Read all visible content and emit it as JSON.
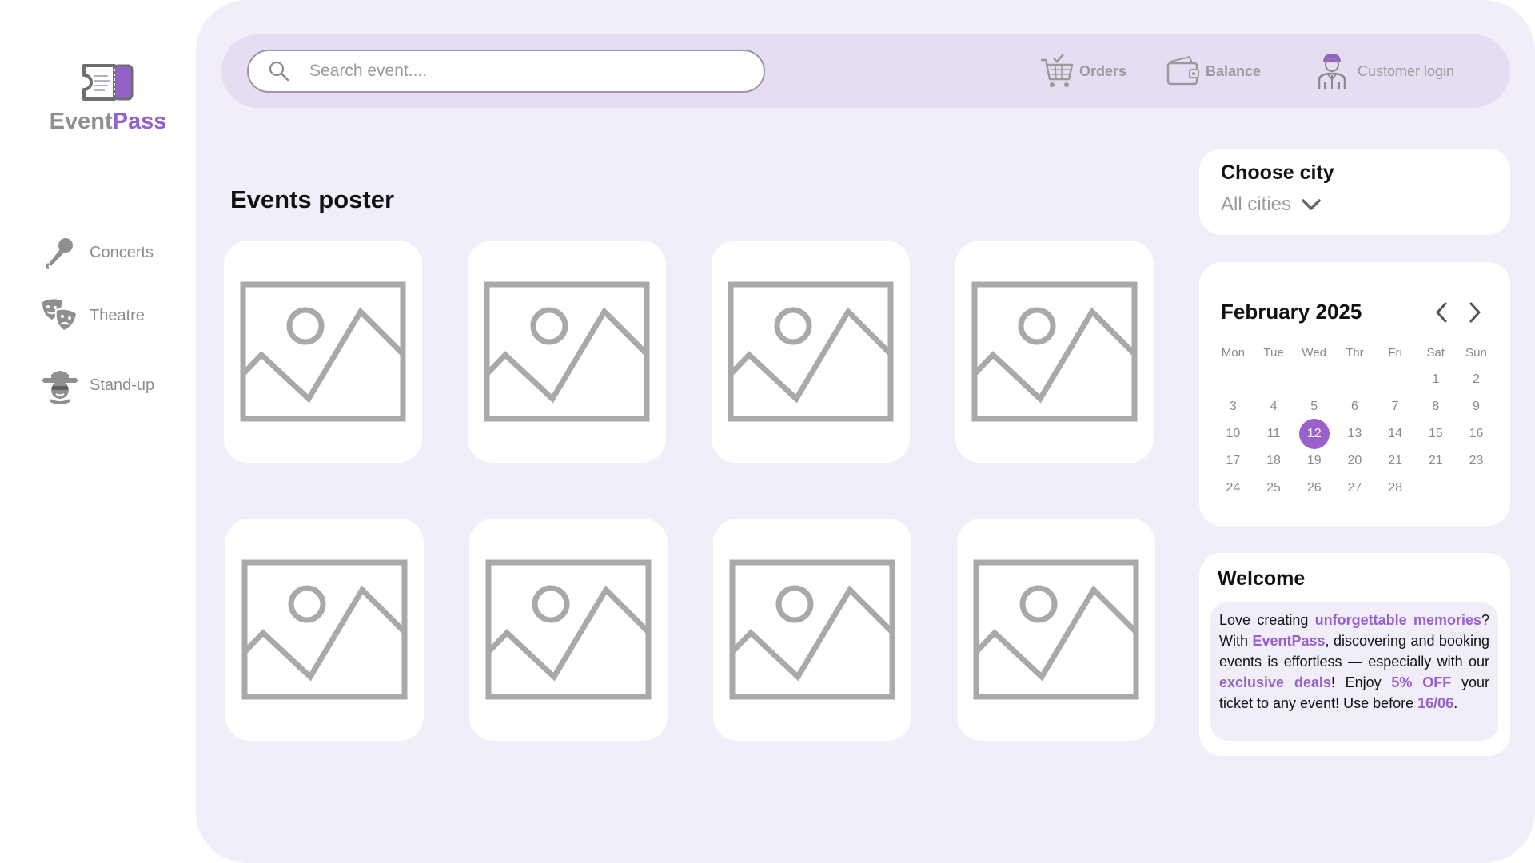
{
  "app": {
    "logo_event": "Event",
    "logo_pass": "Pass"
  },
  "sidebar": {
    "items": [
      {
        "label": "Concerts",
        "icon": "microphone-icon"
      },
      {
        "label": "Theatre",
        "icon": "theatre-masks-icon"
      },
      {
        "label": "Stand-up",
        "icon": "comedian-icon"
      }
    ]
  },
  "header": {
    "search_placeholder": "Search event....",
    "orders_label": "Orders",
    "balance_label": "Balance",
    "login_label": "Customer login"
  },
  "events": {
    "title": "Events poster",
    "cards": [
      "image-placeholder",
      "image-placeholder",
      "image-placeholder",
      "image-placeholder",
      "image-placeholder",
      "image-placeholder",
      "image-placeholder",
      "image-placeholder"
    ]
  },
  "city": {
    "title": "Choose city",
    "selected": "All cities"
  },
  "calendar": {
    "title": "February 2025",
    "weekdays": [
      "Mon",
      "Tue",
      "Wed",
      "Thr",
      "Fri",
      "Sat",
      "Sun"
    ],
    "weeks": [
      [
        "",
        "",
        "",
        "",
        "",
        "1",
        "2"
      ],
      [
        "3",
        "4",
        "5",
        "6",
        "7",
        "8",
        "9"
      ],
      [
        "10",
        "11",
        "12",
        "13",
        "14",
        "15",
        "16"
      ],
      [
        "17",
        "18",
        "19",
        "20",
        "21",
        "21",
        "23"
      ],
      [
        "24",
        "25",
        "26",
        "27",
        "28",
        "",
        ""
      ]
    ],
    "selected_day": "12"
  },
  "welcome": {
    "title": "Welcome",
    "t1": "Love creating ",
    "h1": "unforgettable memories",
    "t2": "? With ",
    "h2": "EventPass",
    "t3": ", discovering and booking events is effortless — especially with our ",
    "h3": "exclusive deals",
    "t4": "! Enjoy ",
    "h4": "5% OFF",
    "t5": " your ticket to any event! Use before ",
    "h5": "16/06",
    "t6": "."
  },
  "colors": {
    "accent": "#9561c9",
    "main_bg": "#f1eef9",
    "topbar_bg": "#e6ddf2",
    "muted_text": "#9a9a9a"
  }
}
